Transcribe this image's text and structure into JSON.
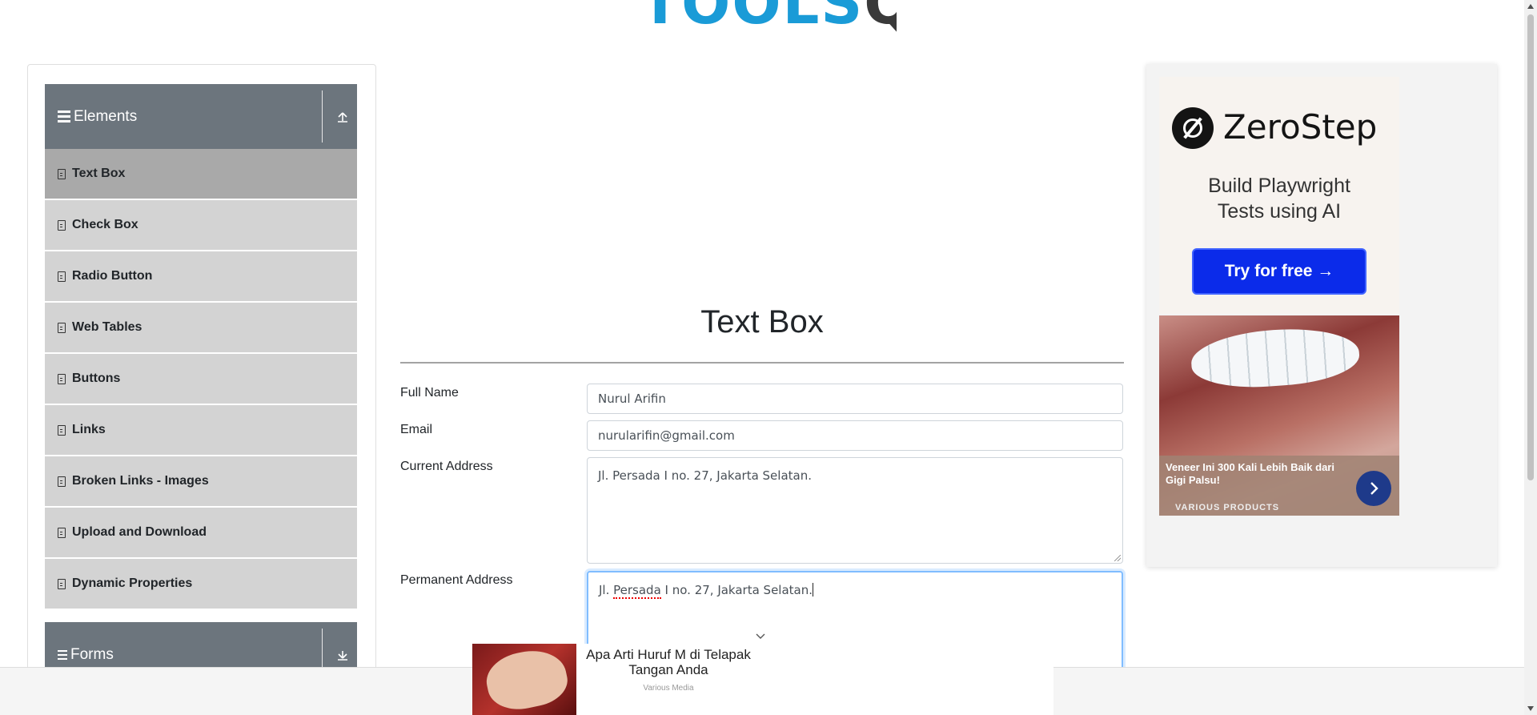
{
  "logo": {
    "part1": "TOOLS",
    "part2": "QA"
  },
  "nav": {
    "elements_group": {
      "title": "Elements",
      "expand_icon": "collapse-up-icon"
    },
    "items": [
      {
        "label": "Text Box",
        "active": true
      },
      {
        "label": "Check Box"
      },
      {
        "label": "Radio Button"
      },
      {
        "label": "Web Tables"
      },
      {
        "label": "Buttons"
      },
      {
        "label": "Links"
      },
      {
        "label": "Broken Links - Images"
      },
      {
        "label": "Upload and Download"
      },
      {
        "label": "Dynamic Properties"
      }
    ],
    "forms_group": {
      "title": "Forms",
      "expand_icon": "expand-down-icon"
    }
  },
  "main": {
    "title": "Text Box",
    "form": {
      "full_name": {
        "label": "Full Name",
        "value": "Nurul Arifin"
      },
      "email": {
        "label": "Email",
        "value": "nurularifin@gmail.com"
      },
      "current_address": {
        "label": "Current Address",
        "value": "Jl. Persada I no. 27, Jakarta Selatan."
      },
      "permanent_address": {
        "label": "Permanent Address",
        "value_before": "Jl. ",
        "value_misspelled": "Persada",
        "value_after": " I no. 27, Jakarta Selatan."
      }
    }
  },
  "ads": {
    "zerostep": {
      "brand": "ZeroStep",
      "tagline_1": "Build Playwright",
      "tagline_2": "Tests using AI",
      "cta": "Try for free →"
    },
    "veneer": {
      "headline": "Veneer Ini 300 Kali Lebih Baik dari Gigi Palsu!",
      "source": "VARIOUS PRODUCTS"
    },
    "bottom": {
      "headline_1": "Apa Arti Huruf M di Telapak",
      "headline_2": "Tangan Anda",
      "source": "Various Media"
    }
  },
  "colors": {
    "nav_header": "#6c757d",
    "nav_item": "#d3d3d3",
    "nav_active": "#a9a9a9",
    "focus": "#80bdff",
    "cta": "#0b2bea"
  }
}
